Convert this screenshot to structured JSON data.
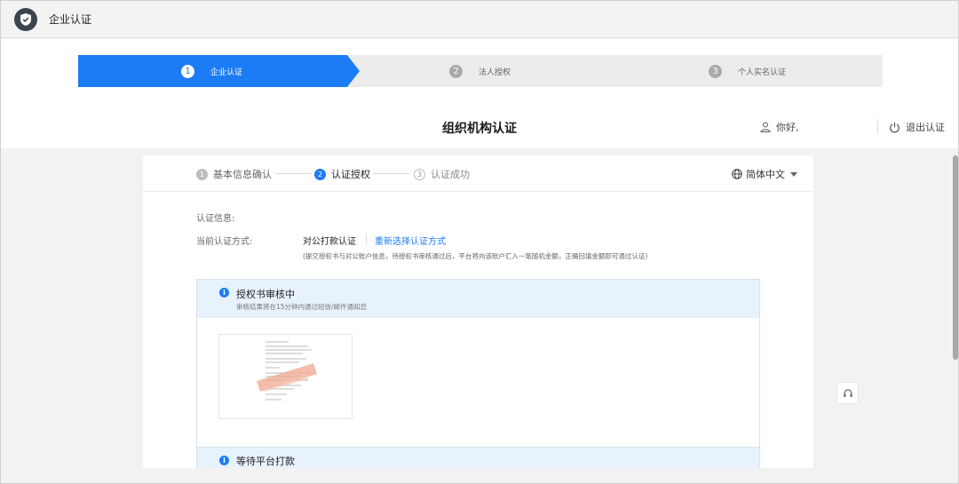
{
  "window": {
    "title": "企业认证"
  },
  "progress": {
    "steps": [
      {
        "num": "1",
        "label": "企业认证",
        "active": true
      },
      {
        "num": "2",
        "label": "法人授权",
        "active": false
      },
      {
        "num": "3",
        "label": "个人实名认证",
        "active": false
      }
    ]
  },
  "header": {
    "title": "组织机构认证",
    "greeting": "你好,",
    "logout": "退出认证"
  },
  "substeps": [
    {
      "num": "1",
      "label": "基本信息确认",
      "state": "done"
    },
    {
      "num": "2",
      "label": "认证授权",
      "state": "current"
    },
    {
      "num": "3",
      "label": "认证成功",
      "state": "todo"
    }
  ],
  "language": {
    "selected": "简体中文"
  },
  "auth_info": {
    "section_label": "认证信息:",
    "method_label": "当前认证方式:",
    "method_value": "对公打款认证",
    "reselect_link": "重新选择认证方式",
    "hint": "(提交授权书与对公账户信息，待授权书审核通过后，平台将向该账户汇入一笔随机金额，正确回填金额即可通过认证)"
  },
  "review_panel": {
    "title": "授权书审核中",
    "subtitle": "审核结果将在15分钟内通过短信/邮件通知您"
  },
  "payment_panel": {
    "title": "等待平台打款"
  },
  "icons": {
    "app": "shield-check-icon",
    "user": "user-icon",
    "power": "power-icon",
    "globe": "globe-icon",
    "info": "info-icon",
    "support": "headset-icon"
  },
  "colors": {
    "accent": "#1c7cf5",
    "info_bg": "#e8f2fd"
  }
}
